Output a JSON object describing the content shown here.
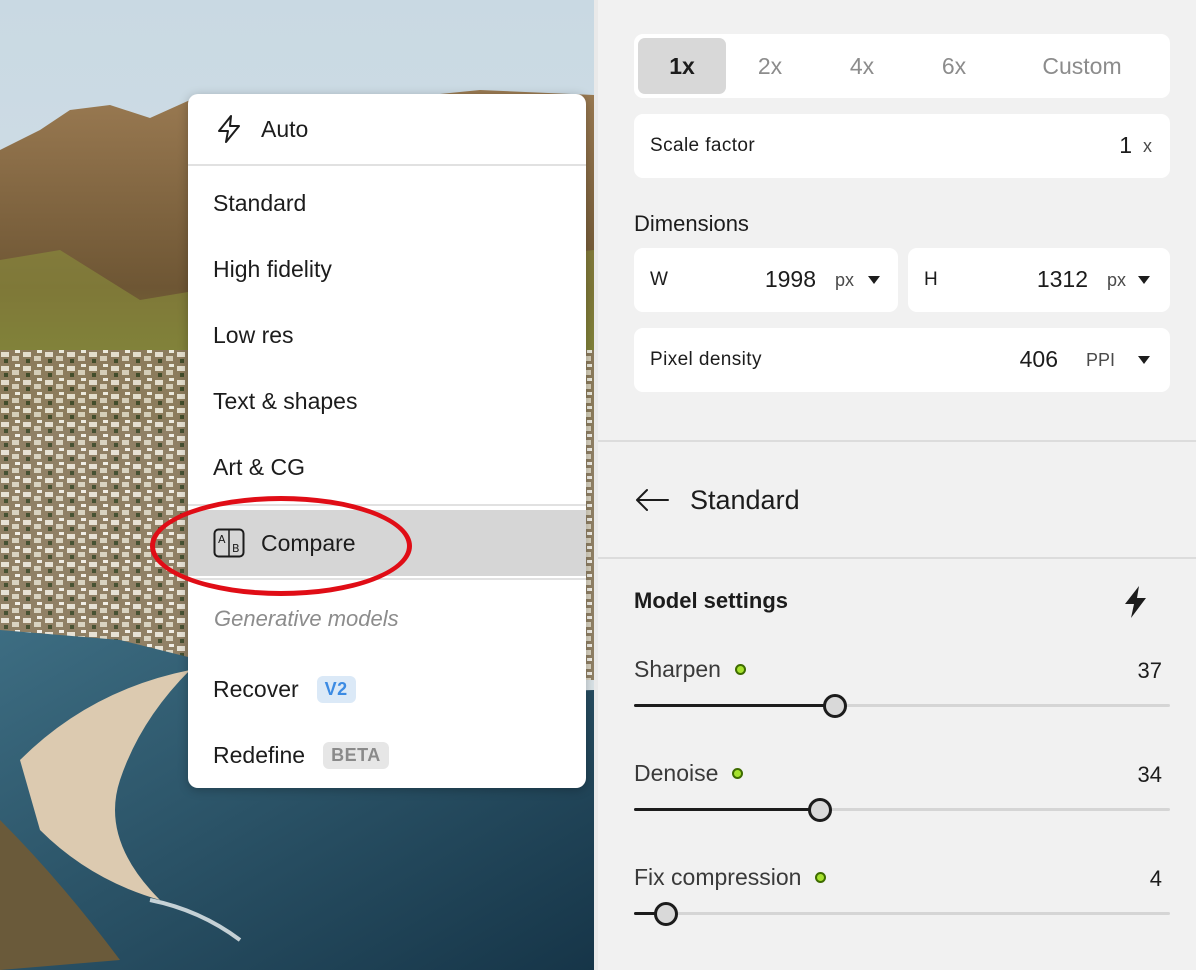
{
  "menu": {
    "auto_label": "Auto",
    "items": [
      "Standard",
      "High fidelity",
      "Low res",
      "Text & shapes",
      "Art & CG"
    ],
    "compare_label": "Compare",
    "section_heading": "Generative models",
    "recover_label": "Recover",
    "recover_badge": "V2",
    "redefine_label": "Redefine",
    "redefine_badge": "BETA"
  },
  "scale": {
    "options": [
      "1x",
      "2x",
      "4x",
      "6x",
      "Custom"
    ],
    "selected": "1x",
    "factor_label": "Scale factor",
    "factor_value": "1",
    "factor_unit": "x"
  },
  "dimensions": {
    "title": "Dimensions",
    "w_label": "W",
    "w_value": "1998",
    "w_unit": "px",
    "h_label": "H",
    "h_value": "1312",
    "h_unit": "px",
    "density_label": "Pixel density",
    "density_value": "406",
    "density_unit": "PPI"
  },
  "model": {
    "back_title": "Standard",
    "settings_title": "Model settings"
  },
  "sliders": [
    {
      "label": "Sharpen",
      "value": 37,
      "display": "37",
      "min": 0,
      "max": 100
    },
    {
      "label": "Denoise",
      "value": 34,
      "display": "34",
      "min": 0,
      "max": 100
    },
    {
      "label": "Fix compression",
      "value": 4,
      "display": "4",
      "min": 0,
      "max": 100
    }
  ],
  "colors": {
    "highlight_ring": "#e00d16",
    "status_dot": "#a6e22e",
    "selected_item": "#d6d6d6",
    "panel_bg": "#f1f1f1"
  }
}
